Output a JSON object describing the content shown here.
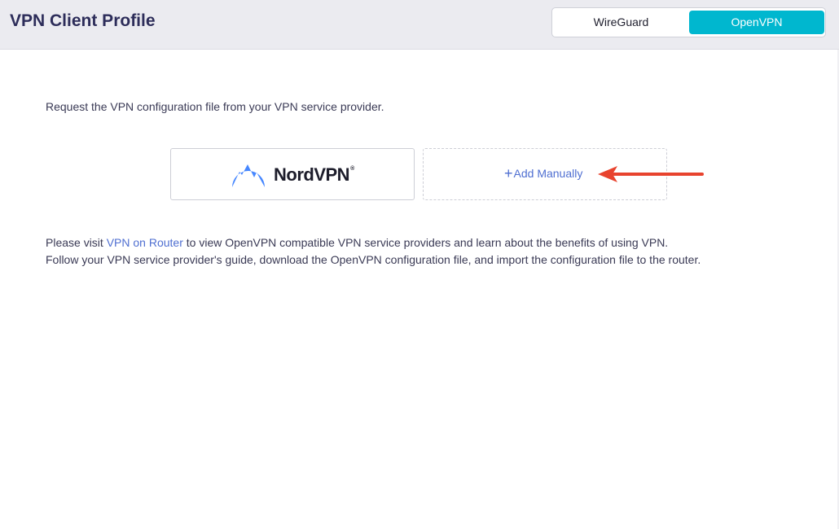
{
  "header": {
    "title": "VPN Client Profile",
    "protocol_toggle": {
      "options": [
        "WireGuard",
        "OpenVPN"
      ],
      "selected": "OpenVPN"
    }
  },
  "main": {
    "intro": "Request the VPN configuration file from your VPN service provider.",
    "providers": [
      {
        "name": "NordVPN",
        "icon": "nordvpn-logo-icon",
        "brand_color": "#4687ff"
      }
    ],
    "add_manually_label": "Add Manually",
    "info": {
      "line1_prefix": "Please visit ",
      "line1_link": "VPN on Router",
      "line1_suffix": " to view OpenVPN compatible VPN service providers and learn about the benefits of using VPN.",
      "line2": "Follow your VPN service provider's guide, download the OpenVPN configuration file, and import the configuration file to the router."
    }
  },
  "colors": {
    "accent": "#00b7cf",
    "link": "#4f6fd1",
    "title": "#2d2d5a",
    "annotation_arrow": "#e8432e"
  }
}
